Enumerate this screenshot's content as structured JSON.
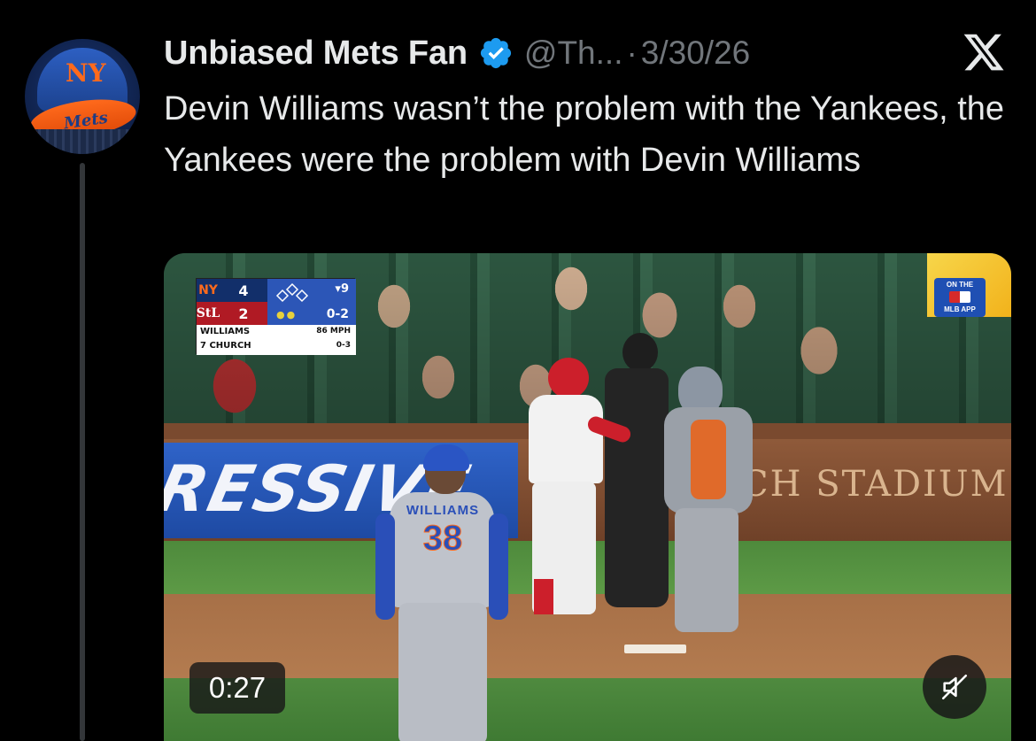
{
  "tweet": {
    "author_name": "Unbiased Mets Fan",
    "handle": "@Th...",
    "separator": "·",
    "date": "3/30/26",
    "text": "Devin Williams wasn’t the problem with the Yankees, the Yankees were the problem with Devin Williams",
    "verified": true
  },
  "avatar": {
    "description_icon": "mets-cap-avatar",
    "cap_logo": "NY",
    "cap_script": "Mets"
  },
  "video": {
    "duration": "0:27",
    "muted": true,
    "scorebug": {
      "away_score": "4",
      "home_score": "2",
      "home_logo": "StL",
      "inning": "▾9",
      "count": "0-2",
      "pitcher": "WILLIAMS",
      "batter": "7 CHURCH",
      "pitch_speed": "86 MPH",
      "batter_line": "0-3"
    },
    "pitcher_jersey_name": "WILLIAMS",
    "pitcher_jersey_number": "38",
    "wall_ad_text": "RESSIVE",
    "stadium_text": "CH STADIUM",
    "badge_top": "ON THE",
    "badge_bottom": "MLB APP"
  },
  "colors": {
    "background": "#000000",
    "text_primary": "#e7e9ea",
    "text_secondary": "#71767b",
    "verified_blue": "#1d9bf0"
  }
}
